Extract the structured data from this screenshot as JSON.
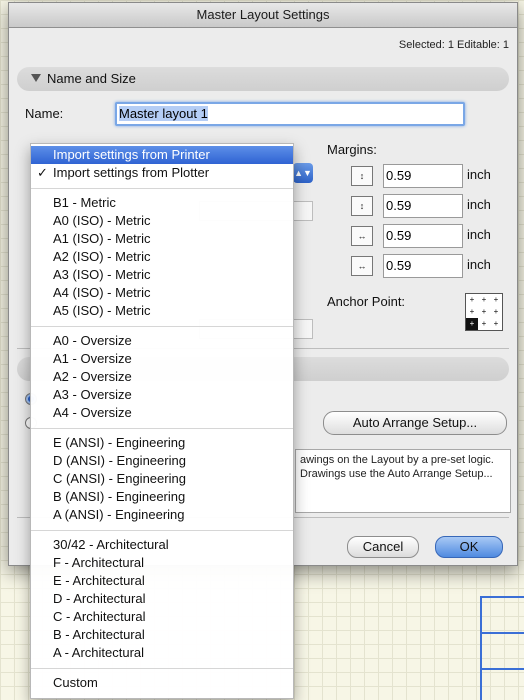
{
  "window": {
    "title": "Master Layout Settings"
  },
  "header": {
    "selected_info": "Selected: 1 Editable: 1"
  },
  "section_name_size": {
    "label": "Name and Size"
  },
  "name": {
    "label": "Name:",
    "value": "Master layout 1"
  },
  "margins": {
    "label": "Margins:",
    "unit": "inch",
    "values": [
      "0.59",
      "0.59",
      "0.59",
      "0.59"
    ]
  },
  "anchor": {
    "label": "Anchor Point:"
  },
  "buttons": {
    "auto_arrange": "Auto Arrange Setup...",
    "cancel": "Cancel",
    "ok": "OK"
  },
  "description": {
    "text": "awings on the Layout by a pre-set logic. Drawings use the Auto Arrange Setup..."
  },
  "size_menu": {
    "import_printer": "Import settings from Printer",
    "import_plotter": "Import settings from Plotter",
    "checkmark": "✓",
    "metric": [
      "B1 - Metric",
      "A0 (ISO) - Metric",
      "A1 (ISO) - Metric",
      "A2 (ISO) - Metric",
      "A3 (ISO) - Metric",
      "A4 (ISO) - Metric",
      "A5 (ISO) - Metric"
    ],
    "oversize": [
      "A0 - Oversize",
      "A1 - Oversize",
      "A2 - Oversize",
      "A3 - Oversize",
      "A4 - Oversize"
    ],
    "engineering": [
      "E (ANSI) - Engineering",
      "D (ANSI) - Engineering",
      "C (ANSI) - Engineering",
      "B (ANSI) - Engineering",
      "A (ANSI) - Engineering"
    ],
    "architectural": [
      "30/42 - Architectural",
      "F - Architectural",
      "E - Architectural",
      "D - Architectural",
      "C - Architectural",
      "B - Architectural",
      "A - Architectural"
    ],
    "custom": "Custom"
  }
}
